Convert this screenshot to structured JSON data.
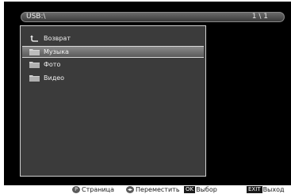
{
  "header": {
    "path": "USB:\\",
    "page_counter": "1 \\ 1"
  },
  "file_list": {
    "items": [
      {
        "label": "Возврат",
        "icon": "return-arrow-icon",
        "selected": false
      },
      {
        "label": "Музыка",
        "icon": "folder-icon",
        "selected": true
      },
      {
        "label": "Фото",
        "icon": "folder-icon",
        "selected": false
      },
      {
        "label": "Видео",
        "icon": "folder-icon",
        "selected": false
      }
    ]
  },
  "footer": {
    "page": {
      "key": "P",
      "label": "Страница"
    },
    "move": {
      "key": "◂▸",
      "label": "Переместить"
    },
    "select": {
      "key": "OK",
      "label": "Выбор"
    },
    "exit": {
      "key": "EXIT",
      "label": "Выход"
    }
  },
  "colors": {
    "screen_bg": "#000000",
    "panel_bg": "#3b3b3b",
    "selection": "#6f6f6f"
  }
}
